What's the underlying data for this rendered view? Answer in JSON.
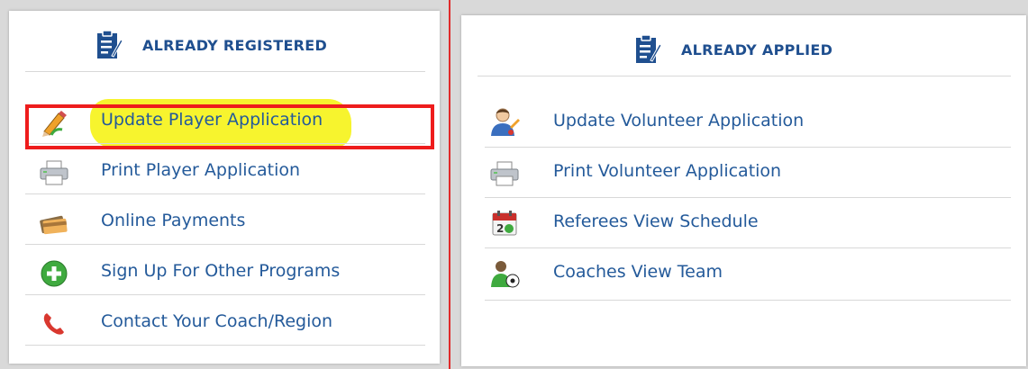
{
  "left": {
    "title": "ALREADY REGISTERED",
    "items": [
      {
        "label": "Update Player Application",
        "icon": "pencil-icon"
      },
      {
        "label": "Print Player Application",
        "icon": "printer-icon"
      },
      {
        "label": "Online Payments",
        "icon": "credit-card-icon"
      },
      {
        "label": "Sign Up For Other Programs",
        "icon": "plus-circle-icon"
      },
      {
        "label": "Contact Your Coach/Region",
        "icon": "phone-icon"
      }
    ]
  },
  "right": {
    "title": "ALREADY APPLIED",
    "items": [
      {
        "label": "Update Volunteer Application",
        "icon": "volunteer-user-icon"
      },
      {
        "label": "Print Volunteer Application",
        "icon": "printer-icon"
      },
      {
        "label": "Referees View Schedule",
        "icon": "calendar-icon"
      },
      {
        "label": "Coaches View Team",
        "icon": "coach-soccer-icon"
      }
    ]
  },
  "colors": {
    "accent": "#245a9a",
    "highlight": "#f7f42e",
    "focus_border": "#ee1c1c"
  }
}
